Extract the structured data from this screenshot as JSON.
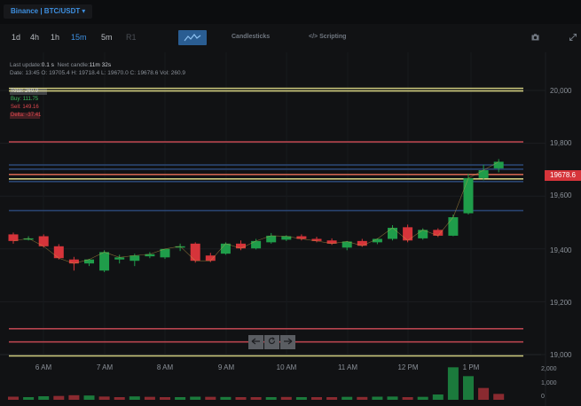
{
  "header": {
    "symbol": "Binance | BTC/USDT",
    "chevron_icon": "chevron-down-icon"
  },
  "toolbar": {
    "timeframes": [
      "1d",
      "4h",
      "1h",
      "15m",
      "5m",
      "R1"
    ],
    "active_timeframe": "15m",
    "indicators_icon": "indicator-wave-icon",
    "candlesticks_label": "Candlesticks",
    "scripting_label": "</> Scripting",
    "camera_icon": "camera-icon",
    "expand_icon": "expand-icon"
  },
  "info": {
    "last_update_label": "Last update:",
    "last_update_value": "0.1 s",
    "next_candle_label": "Next candle:",
    "next_candle_value": "11m 32s",
    "ohlc_line": "Date: 13:45  O: 19705.4  H: 19718.4  L: 19670.0  C: 19678.6  Vol: 260.9"
  },
  "stats": [
    {
      "label": "Total:",
      "value": "260.9",
      "color": "#d0d3d8",
      "fill": 0.75
    },
    {
      "label": "Buy:",
      "value": "111.75",
      "color": "#3fbf5f",
      "fill": 0.0
    },
    {
      "label": "Sell:",
      "value": "149.16",
      "color": "#e0484e",
      "fill": 0.0
    },
    {
      "label": "Delta:",
      "value": "-37.41",
      "color": "#e0484e",
      "fill": 0.6
    }
  ],
  "price_axis": {
    "labels": [
      "20,000",
      "19,800",
      "19,600",
      "19,400",
      "19,200",
      "19,000"
    ],
    "current_price": "19678.6"
  },
  "time_axis": [
    "6 AM",
    "7 AM",
    "8 AM",
    "9 AM",
    "10 AM",
    "11 AM",
    "12 PM",
    "1 PM"
  ],
  "volume_axis": [
    "2,000",
    "1,000",
    "0"
  ],
  "nav_controls": {
    "left_icon": "scroll-left-icon",
    "reset_icon": "reset-icon",
    "right_icon": "scroll-right-icon"
  },
  "colors": {
    "up": "#1f9d4a",
    "down": "#d6343a",
    "accent": "#3d8fe0"
  },
  "chart_data": {
    "type": "candlestick",
    "ylim": [
      18980,
      20050
    ],
    "candles": [
      {
        "t": "5:45",
        "o": 19455,
        "h": 19462,
        "l": 19420,
        "c": 19430
      },
      {
        "t": "6:00",
        "o": 19440,
        "h": 19448,
        "l": 19432,
        "c": 19440
      },
      {
        "t": "6:15",
        "o": 19448,
        "h": 19455,
        "l": 19405,
        "c": 19410
      },
      {
        "t": "6:30",
        "o": 19410,
        "h": 19418,
        "l": 19360,
        "c": 19365
      },
      {
        "t": "6:45",
        "o": 19360,
        "h": 19370,
        "l": 19318,
        "c": 19345
      },
      {
        "t": "7:00",
        "o": 19345,
        "h": 19362,
        "l": 19335,
        "c": 19360
      },
      {
        "t": "7:15",
        "o": 19318,
        "h": 19395,
        "l": 19312,
        "c": 19388
      },
      {
        "t": "7:30",
        "o": 19360,
        "h": 19378,
        "l": 19345,
        "c": 19368
      },
      {
        "t": "7:45",
        "o": 19355,
        "h": 19382,
        "l": 19335,
        "c": 19375
      },
      {
        "t": "8:00",
        "o": 19372,
        "h": 19388,
        "l": 19365,
        "c": 19380
      },
      {
        "t": "8:15",
        "o": 19368,
        "h": 19398,
        "l": 19362,
        "c": 19400
      },
      {
        "t": "8:30",
        "o": 19405,
        "h": 19420,
        "l": 19392,
        "c": 19410
      },
      {
        "t": "8:45",
        "o": 19420,
        "h": 19425,
        "l": 19348,
        "c": 19355
      },
      {
        "t": "9:00",
        "o": 19375,
        "h": 19385,
        "l": 19350,
        "c": 19355
      },
      {
        "t": "9:15",
        "o": 19382,
        "h": 19425,
        "l": 19378,
        "c": 19420
      },
      {
        "t": "9:30",
        "o": 19420,
        "h": 19432,
        "l": 19395,
        "c": 19402
      },
      {
        "t": "9:45",
        "o": 19402,
        "h": 19438,
        "l": 19398,
        "c": 19430
      },
      {
        "t": "10:00",
        "o": 19425,
        "h": 19460,
        "l": 19420,
        "c": 19450
      },
      {
        "t": "10:15",
        "o": 19435,
        "h": 19452,
        "l": 19430,
        "c": 19448
      },
      {
        "t": "10:30",
        "o": 19448,
        "h": 19455,
        "l": 19432,
        "c": 19438
      },
      {
        "t": "10:45",
        "o": 19438,
        "h": 19446,
        "l": 19425,
        "c": 19430
      },
      {
        "t": "11:00",
        "o": 19432,
        "h": 19440,
        "l": 19415,
        "c": 19420
      },
      {
        "t": "11:15",
        "o": 19405,
        "h": 19430,
        "l": 19395,
        "c": 19428
      },
      {
        "t": "11:30",
        "o": 19430,
        "h": 19438,
        "l": 19408,
        "c": 19412
      },
      {
        "t": "11:45",
        "o": 19425,
        "h": 19440,
        "l": 19418,
        "c": 19438
      },
      {
        "t": "12:00",
        "o": 19438,
        "h": 19490,
        "l": 19432,
        "c": 19480
      },
      {
        "t": "12:15",
        "o": 19482,
        "h": 19492,
        "l": 19425,
        "c": 19432
      },
      {
        "t": "12:30",
        "o": 19440,
        "h": 19478,
        "l": 19435,
        "c": 19472
      },
      {
        "t": "12:45",
        "o": 19472,
        "h": 19478,
        "l": 19445,
        "c": 19450
      },
      {
        "t": "13:00",
        "o": 19450,
        "h": 19530,
        "l": 19448,
        "c": 19520
      },
      {
        "t": "13:15",
        "o": 19535,
        "h": 19685,
        "l": 19530,
        "c": 19668
      },
      {
        "t": "13:30",
        "o": 19668,
        "h": 19718,
        "l": 19660,
        "c": 19698
      },
      {
        "t": "13:45",
        "o": 19705,
        "h": 19740,
        "l": 19690,
        "c": 19730
      }
    ],
    "levels": [
      {
        "price": 20008,
        "color": "#e4e08a"
      },
      {
        "price": 19998,
        "color": "#e4e08a"
      },
      {
        "price": 19805,
        "color": "#c84a55"
      },
      {
        "price": 19718,
        "color": "#2c4a7a"
      },
      {
        "price": 19702,
        "color": "#2c4a7a"
      },
      {
        "price": 19682,
        "color": "#e06a55"
      },
      {
        "price": 19665,
        "color": "#e4e08a"
      },
      {
        "price": 19655,
        "color": "#2c4a7a"
      },
      {
        "price": 19545,
        "color": "#2c4a7a"
      },
      {
        "price": 19098,
        "color": "#c84a55"
      },
      {
        "price": 19048,
        "color": "#c84a55"
      },
      {
        "price": 18995,
        "color": "#e4e08a"
      }
    ],
    "volume": [
      {
        "v": 210,
        "up": false
      },
      {
        "v": 180,
        "up": true
      },
      {
        "v": 240,
        "up": true
      },
      {
        "v": 260,
        "up": false
      },
      {
        "v": 310,
        "up": false
      },
      {
        "v": 290,
        "up": true
      },
      {
        "v": 220,
        "up": false
      },
      {
        "v": 180,
        "up": false
      },
      {
        "v": 230,
        "up": true
      },
      {
        "v": 200,
        "up": false
      },
      {
        "v": 160,
        "up": false
      },
      {
        "v": 180,
        "up": true
      },
      {
        "v": 210,
        "up": true
      },
      {
        "v": 200,
        "up": false
      },
      {
        "v": 190,
        "up": true
      },
      {
        "v": 170,
        "up": false
      },
      {
        "v": 180,
        "up": false
      },
      {
        "v": 160,
        "up": true
      },
      {
        "v": 190,
        "up": false
      },
      {
        "v": 150,
        "up": true
      },
      {
        "v": 180,
        "up": false
      },
      {
        "v": 170,
        "up": false
      },
      {
        "v": 200,
        "up": true
      },
      {
        "v": 190,
        "up": false
      },
      {
        "v": 210,
        "up": true
      },
      {
        "v": 220,
        "up": true
      },
      {
        "v": 180,
        "up": false
      },
      {
        "v": 200,
        "up": true
      },
      {
        "v": 360,
        "up": true
      },
      {
        "v": 2200,
        "up": true
      },
      {
        "v": 1600,
        "up": true
      },
      {
        "v": 800,
        "up": false
      },
      {
        "v": 400,
        "up": false
      }
    ],
    "vol_max": 2400
  }
}
